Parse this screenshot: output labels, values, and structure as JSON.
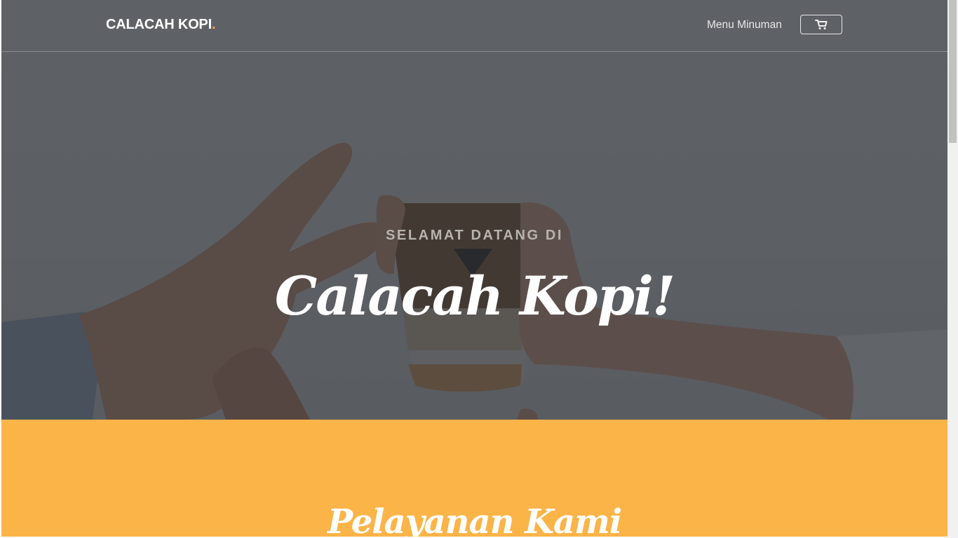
{
  "navbar": {
    "brand": "CALACAH KOPI",
    "brand_dot": ".",
    "menu_link": "Menu Minuman",
    "cart_icon": "cart-icon"
  },
  "hero": {
    "subtitle": "SELAMAT DATANG DI",
    "headline": "Calacah Kopi!"
  },
  "services": {
    "title": "Pelayanan Kami"
  },
  "colors": {
    "accent": "#fbb448",
    "brand_dot": "#f4a93c",
    "overlay": "#2c3036"
  }
}
